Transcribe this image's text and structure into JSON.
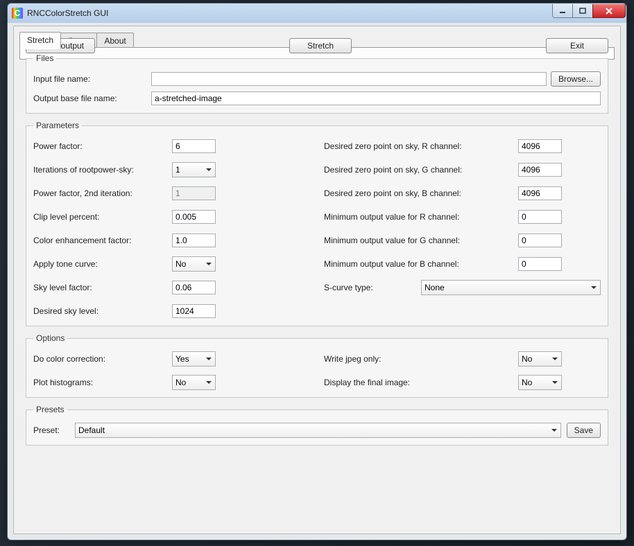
{
  "window": {
    "title": "RNCColorStretch GUI",
    "icon_letter": "C"
  },
  "tabs": {
    "stretch": "Stretch",
    "setup": "Setup",
    "about": "About"
  },
  "files": {
    "legend": "Files",
    "input_label": "Input file name:",
    "input_value": "",
    "browse_label": "Browse...",
    "output_label": "Output base file name:",
    "output_value": "a-stretched-image"
  },
  "params": {
    "legend": "Parameters",
    "power_factor_label": "Power factor:",
    "power_factor_value": "6",
    "iterations_label": "Iterations of rootpower-sky:",
    "iterations_value": "1",
    "power_factor2_label": "Power factor, 2nd iteration:",
    "power_factor2_value": "1",
    "clip_label": "Clip level percent:",
    "clip_value": "0.005",
    "color_enh_label": "Color enhancement factor:",
    "color_enh_value": "1.0",
    "tone_curve_label": "Apply tone curve:",
    "tone_curve_value": "No",
    "sky_factor_label": "Sky level factor:",
    "sky_factor_value": "0.06",
    "desired_sky_label": "Desired sky level:",
    "desired_sky_value": "1024",
    "zero_r_label": "Desired zero point on sky, R channel:",
    "zero_r_value": "4096",
    "zero_g_label": "Desired zero point on sky, G channel:",
    "zero_g_value": "4096",
    "zero_b_label": "Desired zero point on sky, B channel:",
    "zero_b_value": "4096",
    "min_r_label": "Minimum output value for R channel:",
    "min_r_value": "0",
    "min_g_label": "Minimum output value for G channel:",
    "min_g_value": "0",
    "min_b_label": "Minimum output value for B channel:",
    "min_b_value": "0",
    "scurve_label": "S-curve type:",
    "scurve_value": "None"
  },
  "options": {
    "legend": "Options",
    "color_corr_label": "Do color correction:",
    "color_corr_value": "Yes",
    "histograms_label": "Plot histograms:",
    "histograms_value": "No",
    "jpeg_label": "Write jpeg only:",
    "jpeg_value": "No",
    "display_label": "Display the final image:",
    "display_value": "No"
  },
  "presets": {
    "legend": "Presets",
    "preset_label": "Preset:",
    "preset_value": "Default",
    "save_label": "Save"
  },
  "bottom": {
    "clean_label": "Clean output",
    "stretch_label": "Stretch",
    "exit_label": "Exit"
  },
  "select_values": {
    "yes": "Yes",
    "no": "No",
    "one": "1",
    "none": "None",
    "default": "Default"
  }
}
